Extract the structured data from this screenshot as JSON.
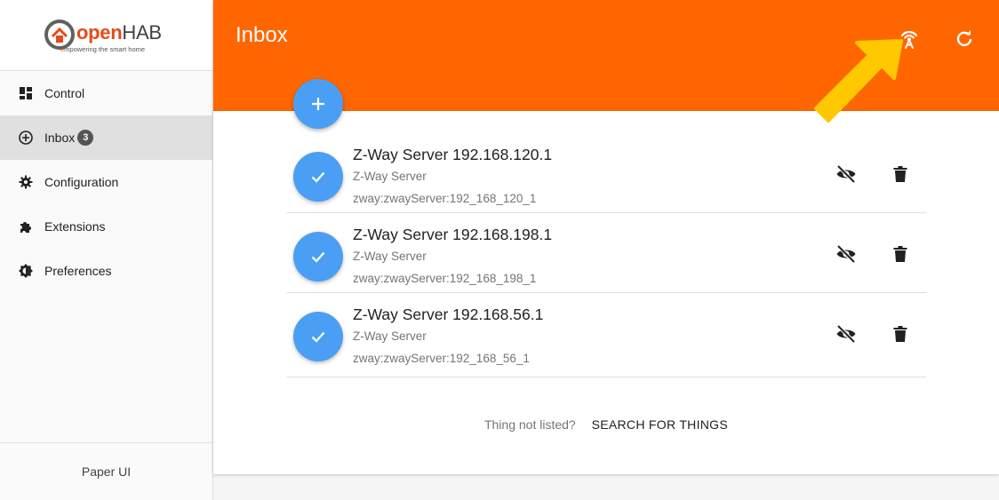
{
  "app": {
    "logo_open": "open",
    "logo_hab": "HAB",
    "logo_tag_prefix": "e",
    "logo_tag": "mpowering the smart home",
    "footer": "Paper UI"
  },
  "sidebar": {
    "items": [
      {
        "label": "Control",
        "icon": "dashboard-icon"
      },
      {
        "label": "Inbox",
        "icon": "add-circle-icon",
        "badge": "3"
      },
      {
        "label": "Configuration",
        "icon": "gear-icon"
      },
      {
        "label": "Extensions",
        "icon": "puzzle-icon"
      },
      {
        "label": "Preferences",
        "icon": "brightness-icon"
      }
    ]
  },
  "header": {
    "title": "Inbox",
    "icons": [
      "scan-antenna-icon",
      "refresh-icon"
    ]
  },
  "inbox": {
    "items": [
      {
        "title": "Z-Way Server 192.168.120.1",
        "subtitle": "Z-Way Server",
        "uid": "zway:zwayServer:192_168_120_1"
      },
      {
        "title": "Z-Way Server 192.168.198.1",
        "subtitle": "Z-Way Server",
        "uid": "zway:zwayServer:192_168_198_1"
      },
      {
        "title": "Z-Way Server 192.168.56.1",
        "subtitle": "Z-Way Server",
        "uid": "zway:zwayServer:192_168_56_1"
      }
    ],
    "not_listed": "Thing not listed?",
    "search_label": "SEARCH FOR THINGS"
  },
  "colors": {
    "brand_orange": "#ff6600",
    "accent_blue": "#4a9ff5",
    "arrow_yellow": "#ffc800"
  }
}
